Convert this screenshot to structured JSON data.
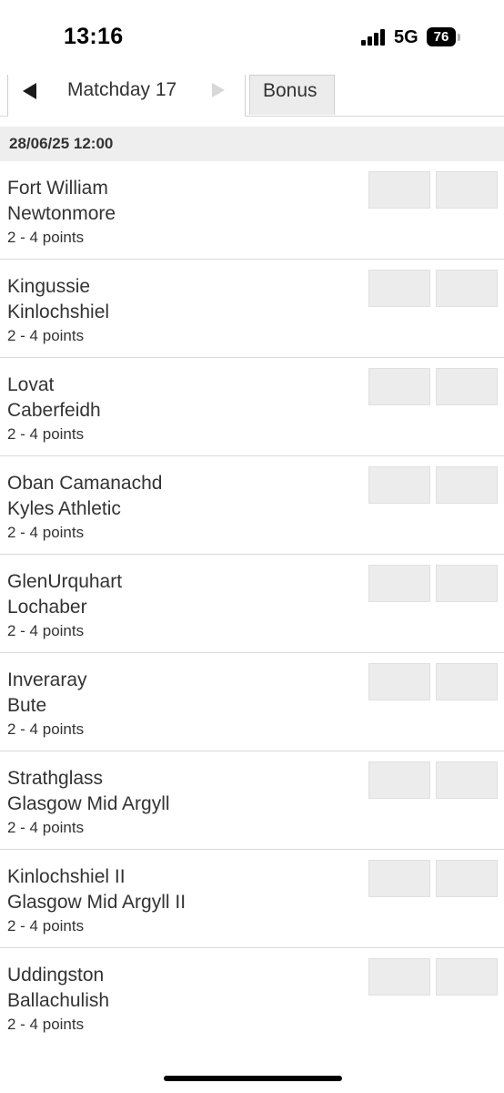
{
  "status_bar": {
    "time": "13:16",
    "network": "5G",
    "battery": "76"
  },
  "tabs": {
    "matchday_label": "Matchday 17",
    "bonus_label": "Bonus"
  },
  "date_header": "28/06/25 12:00",
  "matches": [
    {
      "home": "Fort William",
      "away": "Newtonmore",
      "points": "2 - 4 points"
    },
    {
      "home": "Kingussie",
      "away": "Kinlochshiel",
      "points": "2 - 4 points"
    },
    {
      "home": "Lovat",
      "away": "Caberfeidh",
      "points": "2 - 4 points"
    },
    {
      "home": "Oban Camanachd",
      "away": "Kyles Athletic",
      "points": "2 - 4 points"
    },
    {
      "home": "GlenUrquhart",
      "away": "Lochaber",
      "points": "2 - 4 points"
    },
    {
      "home": "Inveraray",
      "away": "Bute",
      "points": "2 - 4 points"
    },
    {
      "home": "Strathglass",
      "away": "Glasgow Mid Argyll",
      "points": "2 - 4 points"
    },
    {
      "home": "Kinlochshiel II",
      "away": "Glasgow Mid Argyll II",
      "points": "2 - 4 points"
    },
    {
      "home": "Uddingston",
      "away": "Ballachulish",
      "points": "2 - 4 points"
    }
  ]
}
